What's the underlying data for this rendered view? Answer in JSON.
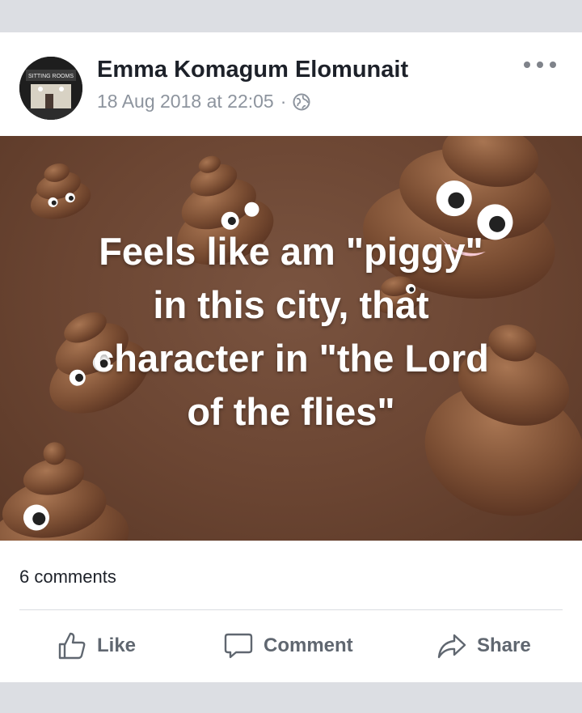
{
  "post": {
    "author": "Emma Komagum Elomunait",
    "timestamp": "18 Aug 2018 at 22:05",
    "separator": "·",
    "privacy_icon": "globe-icon",
    "more_icon": "more-options-icon",
    "avatar_sign_text": "SITTING ROOMS",
    "image_text": "Feels like am \"piggy\"\nin this city, that\ncharacter in \"the Lord\nof the flies\"",
    "comments_count": "6 comments"
  },
  "actions": {
    "like_label": "Like",
    "comment_label": "Comment",
    "share_label": "Share"
  },
  "colors": {
    "name": "#1d2129",
    "meta": "#8d949e",
    "action": "#606770",
    "image_bg": "#6b4532"
  }
}
